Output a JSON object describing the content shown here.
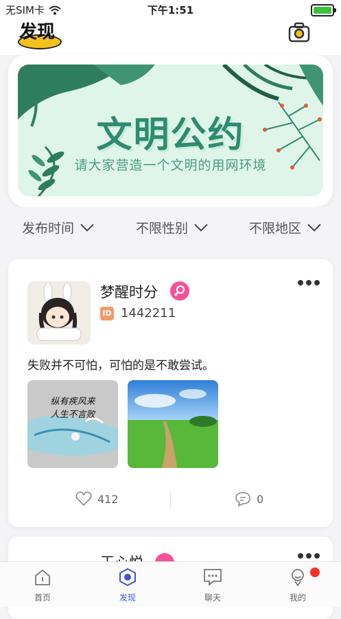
{
  "status_bar": {
    "carrier": "无SIM卡",
    "time": "下午1:51"
  },
  "header": {
    "title": "发现"
  },
  "banner": {
    "title": "文明公约",
    "subtitle": "请大家营造一个文明的用网环境"
  },
  "filters": [
    {
      "label": "发布时间"
    },
    {
      "label": "不限性别"
    },
    {
      "label": "不限地区"
    }
  ],
  "post": {
    "username": "梦醒时分",
    "id_label": "ID",
    "id_number": "1442211",
    "content": "失败并不可怕，可怕的是不敢尝试。",
    "image1_caption": [
      "纵有疾风来",
      "人生不言败"
    ],
    "likes": "412",
    "comments": "0"
  },
  "post2": {
    "username": "王心悦"
  },
  "tabbar": [
    {
      "label": "首页",
      "icon": "home-icon"
    },
    {
      "label": "发现",
      "icon": "discover-icon"
    },
    {
      "label": "聊天",
      "icon": "chat-icon"
    },
    {
      "label": "我的",
      "icon": "profile-icon"
    }
  ],
  "colors": {
    "accent": "#4355d6",
    "female": "#f7509a",
    "badge": "#f0312a",
    "banner_text": "#2e8a70"
  }
}
